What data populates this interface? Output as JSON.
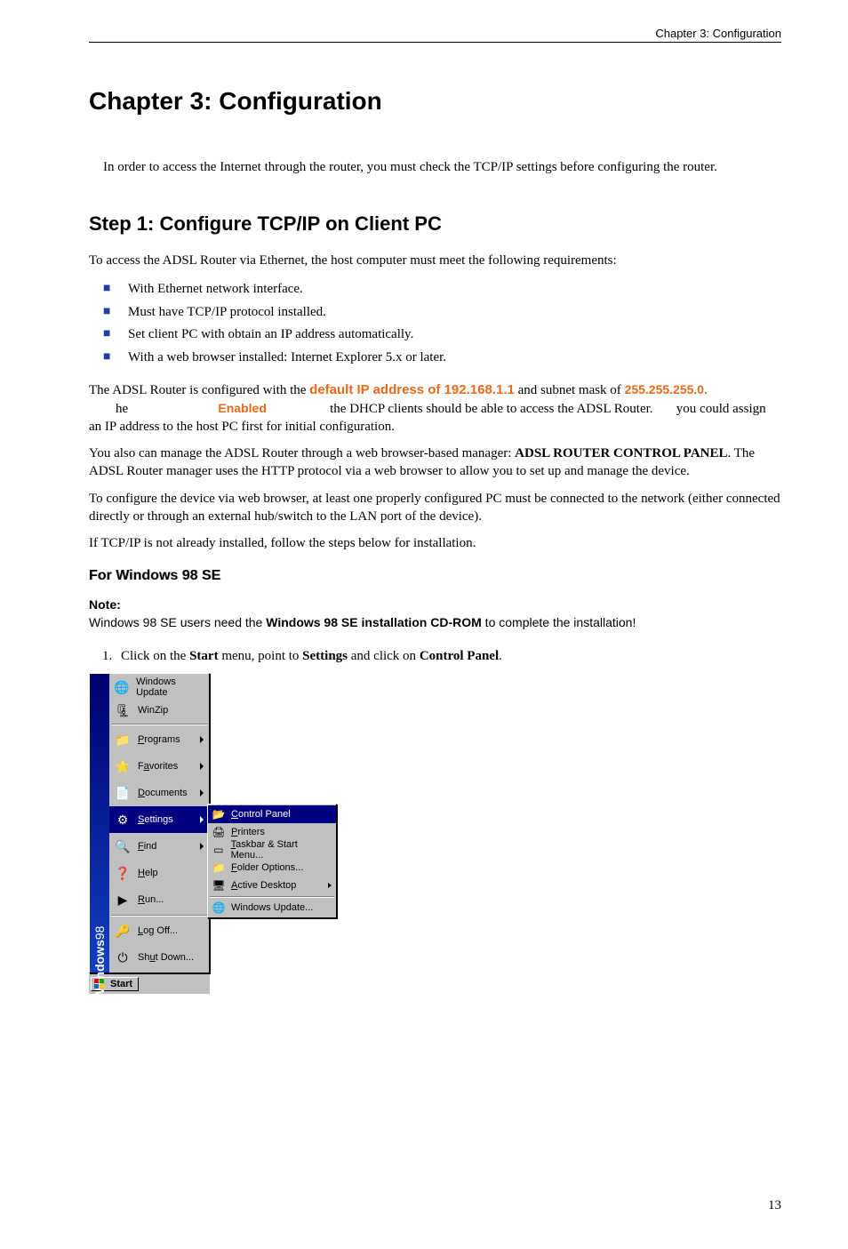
{
  "header": "Chapter 3: Configuration",
  "h1": "Chapter 3: Configuration",
  "intro": "In order to access the Internet through the router, you must check the TCP/IP settings before configuring the router.",
  "h2": "Step 1: Configure TCP/IP on Client PC",
  "p_req": "To access the ADSL Router via Ethernet, the host computer must meet the following requirements:",
  "bullets": [
    "With Ethernet network interface.",
    "Must have TCP/IP protocol installed.",
    "Set client PC with obtain an IP address automatically.",
    "With a web browser installed: Internet Explorer 5.x or later."
  ],
  "ip_para": {
    "pre": "The ADSL Router is configured with the ",
    "default_ip": "default IP address of 192.168.1.1",
    "mid1": " and subnet mask of ",
    "mask": "255.255.255.0.",
    "gap1": "        he                           ",
    "enabled": "Enabled",
    "mid2": "                   the DHCP clients should be able to access the ADSL Router.       you could assign an IP address to the host PC first for initial configuration."
  },
  "p_manage_a": "You also can manage the ADSL Router through a web browser-based manager: ",
  "p_manage_b": "ADSL ROUTER CONTROL PANEL",
  "p_manage_c": ". The ADSL Router manager uses the HTTP protocol via a web browser to allow you to set up and manage the device.",
  "p_config": "To configure the device via web browser, at least one properly configured PC must be connected to the network (either connected directly or through an external hub/switch to the LAN port of the device).",
  "p_tcpip": "If TCP/IP is not already installed, follow the steps below for installation.",
  "h3": "For Windows 98 SE",
  "note": {
    "label": "Note:",
    "text_a": "Windows 98 SE users need the ",
    "text_b": "Windows 98 SE installation CD-ROM",
    "text_c": " to complete the installation!"
  },
  "step1_a": "Click on the ",
  "step1_b": "Start",
  "step1_c": " menu, point to ",
  "step1_d": "Settings",
  "step1_e": " and click on ",
  "step1_f": "Control Panel",
  "step1_g": ".",
  "startmenu": {
    "brand_a": "Windows",
    "brand_b": "98",
    "top": [
      "Windows Update",
      "WinZip"
    ],
    "items": [
      {
        "icon": "📁",
        "label": "Programs",
        "u": "P",
        "arrow": true
      },
      {
        "icon": "⭐",
        "label": "Favorites",
        "u": "a",
        "arrow": true
      },
      {
        "icon": "📄",
        "label": "Documents",
        "u": "D",
        "arrow": true
      },
      {
        "icon": "⚙",
        "label": "Settings",
        "u": "S",
        "arrow": true,
        "hl": true
      },
      {
        "icon": "🔍",
        "label": "Find",
        "u": "F",
        "arrow": true
      },
      {
        "icon": "❓",
        "label": "Help",
        "u": "H"
      },
      {
        "icon": "▶",
        "label": "Run...",
        "u": "R"
      }
    ],
    "bottom": [
      {
        "icon": "🔑",
        "label": "Log Off...",
        "u": "L"
      },
      {
        "icon": "⏻",
        "label": "Shut Down...",
        "u": "u"
      }
    ],
    "submenu": [
      {
        "icon": "📂",
        "label": "Control Panel",
        "u": "C",
        "hl": true
      },
      {
        "icon": "🖨",
        "label": "Printers",
        "u": "P"
      },
      {
        "icon": "▭",
        "label": "Taskbar & Start Menu...",
        "u": "T"
      },
      {
        "icon": "📁",
        "label": "Folder Options...",
        "u": "F"
      },
      {
        "icon": "🖥",
        "label": "Active Desktop",
        "u": "A",
        "arrow": true
      }
    ],
    "submenu_extra": {
      "icon": "🌐",
      "label": "Windows Update..."
    },
    "startbtn": "Start"
  },
  "pagenum": "13"
}
